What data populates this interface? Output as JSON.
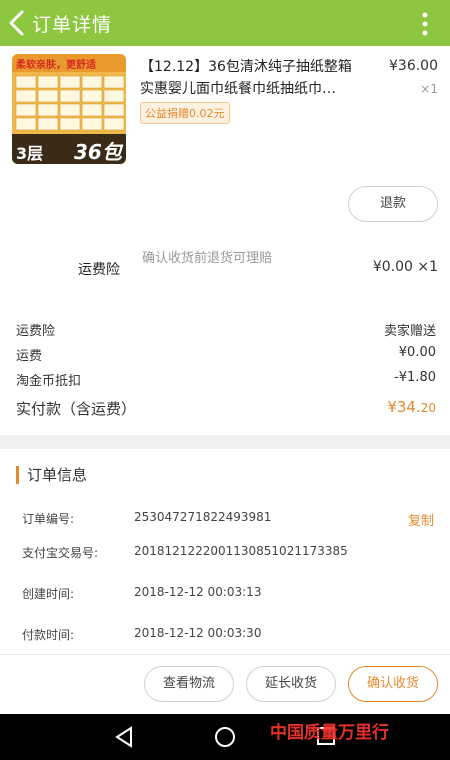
{
  "header": {
    "title": "订单详情"
  },
  "product": {
    "title": "【12.12】36包清沐纯子抽纸整箱实惠婴儿面巾纸餐巾纸抽纸巾…",
    "price": "¥36.00",
    "quantity": "×1",
    "tag": "公益捐赠0.02元",
    "thumb_top_text": "柔软亲肤，更舒适",
    "thumb_badge_a": "3层",
    "thumb_badge_b": "36包"
  },
  "refund_button": "退款",
  "insurance": {
    "label": "运费险",
    "description": "确认收货前退货可理赔",
    "price": "¥0.00 ×1"
  },
  "summary": [
    {
      "label": "运费险",
      "value": "卖家赠送"
    },
    {
      "label": "运费",
      "value": "¥0.00"
    },
    {
      "label": "淘金币抵扣",
      "value": "-¥1.80"
    }
  ],
  "total": {
    "label": "实付款（含运费）",
    "value_main": "¥34.",
    "value_cents": "20"
  },
  "order_info": {
    "title": "订单信息",
    "rows": [
      {
        "label": "订单编号:",
        "value": "253047271822493981"
      },
      {
        "label": "支付宝交易号:",
        "value": "2018121222001130851021173385"
      },
      {
        "label": "创建时间:",
        "value": "2018-12-12 00:03:13"
      },
      {
        "label": "付款时间:",
        "value": "2018-12-12 00:03:30"
      }
    ],
    "copy_label": "复制"
  },
  "footer": {
    "logistics": "查看物流",
    "extend": "延长收货",
    "confirm": "确认收货"
  },
  "watermark": "中国质量万里行",
  "colors": {
    "header": "#8dc63f",
    "accent": "#e38a2c"
  }
}
